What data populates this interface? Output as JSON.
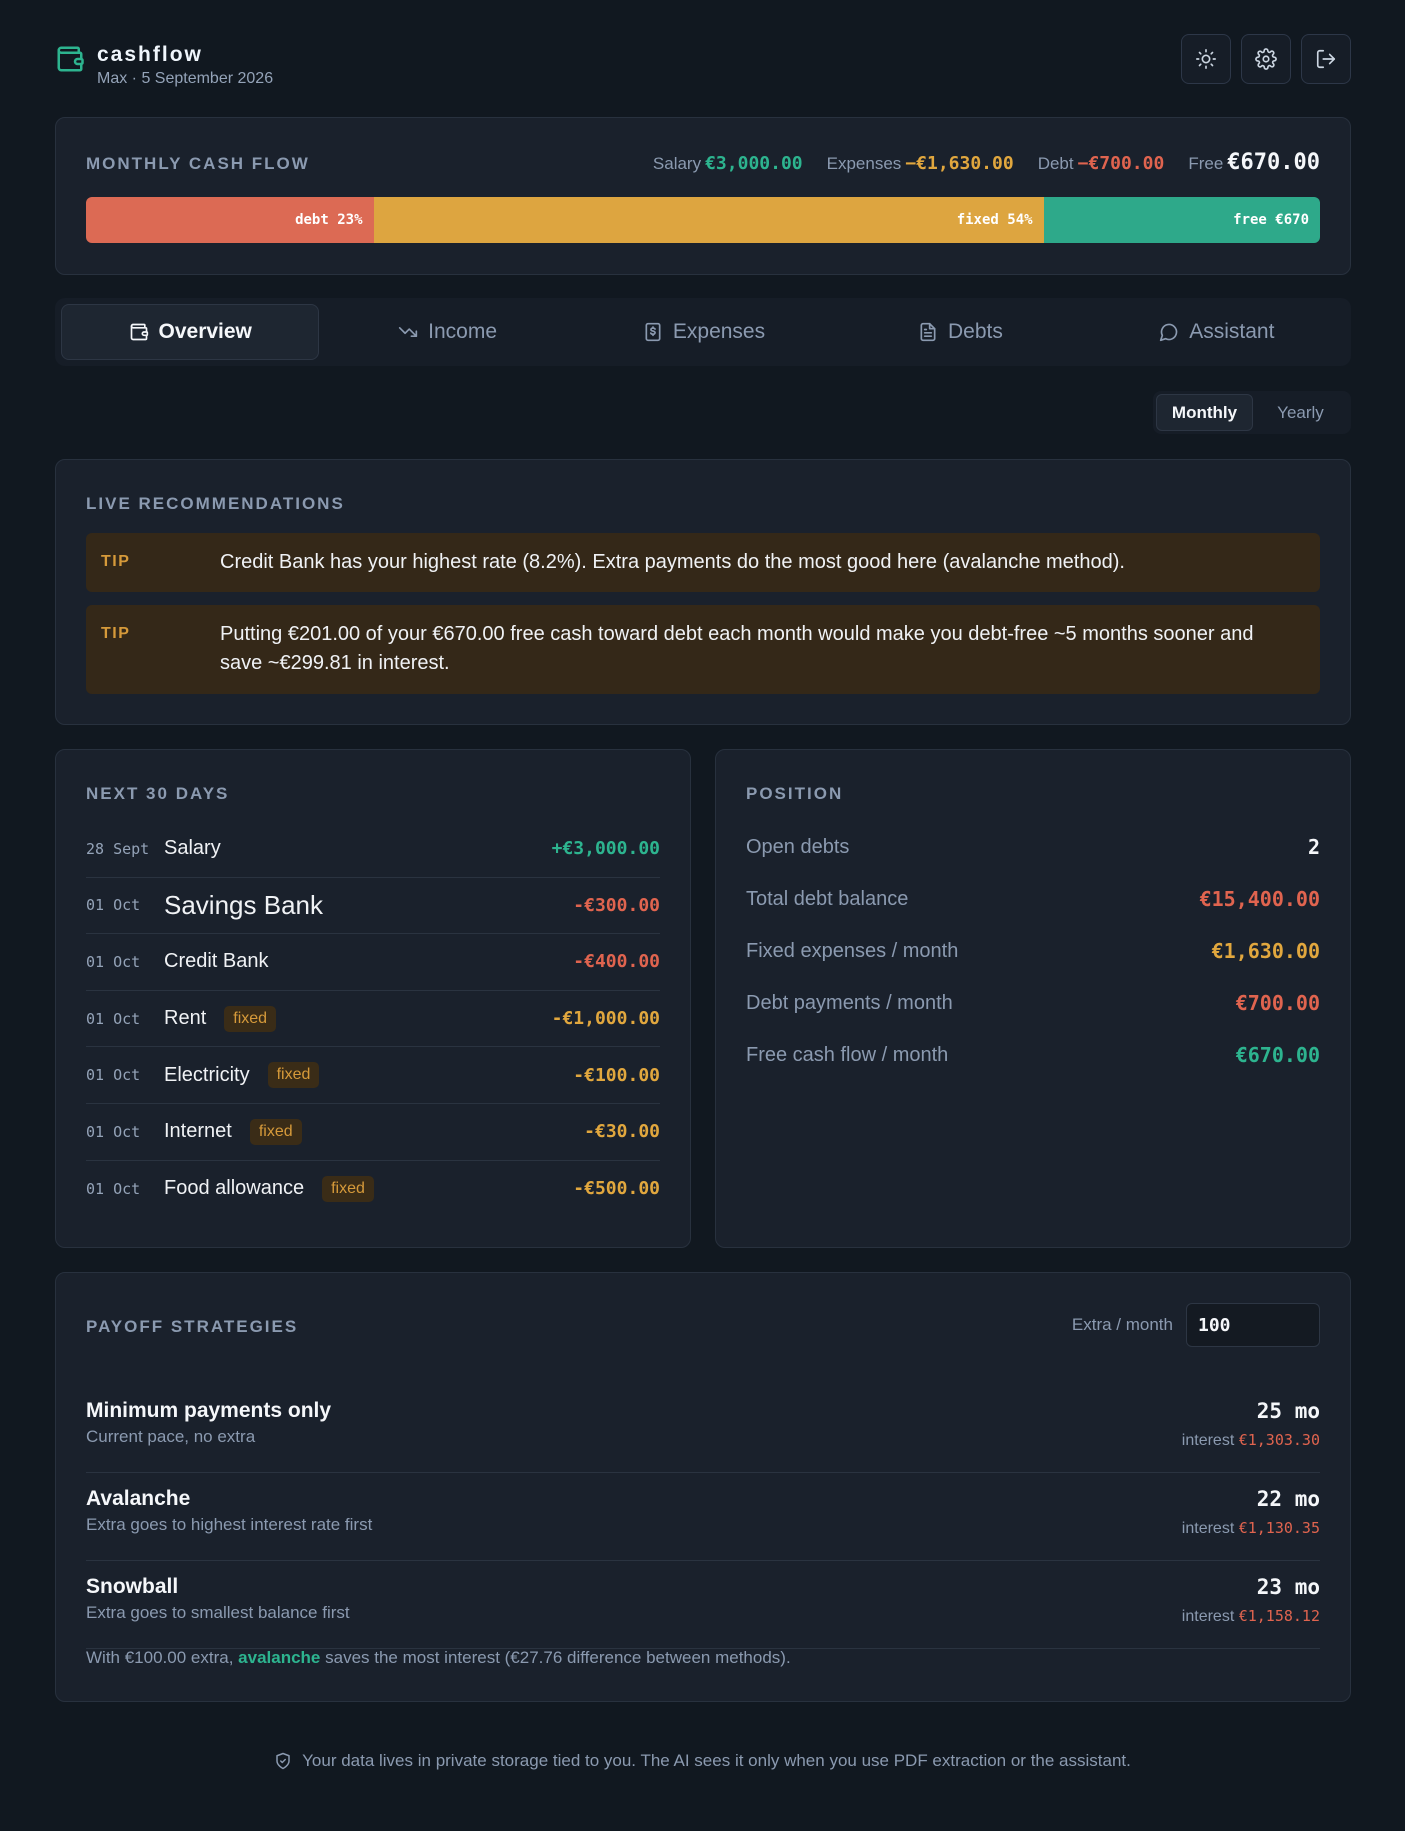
{
  "header": {
    "app_name": "cashflow",
    "subtitle": "Max · 5 September 2026",
    "icons": [
      "wallet-icon",
      "sun-icon",
      "gear-icon",
      "logout-icon"
    ]
  },
  "cashflow": {
    "title": "MONTHLY CASH FLOW",
    "salary_label": "Salary",
    "salary_value": "€3,000.00",
    "expenses_label": "Expenses",
    "expenses_value": "−€1,630.00",
    "debt_label": "Debt",
    "debt_value": "−€700.00",
    "free_label": "Free",
    "free_value": "€670.00",
    "bar": {
      "debt_label": "debt 23%",
      "debt_fraction": 0.233,
      "fixed_label": "fixed 54%",
      "fixed_fraction": 0.543,
      "free_label": "free €670",
      "free_fraction": 0.224
    },
    "colors": {
      "debt": "#dc6a54",
      "fixed": "#dda540",
      "free": "#2ea98a"
    }
  },
  "tabs": [
    {
      "label": "Overview",
      "icon": "wallet-icon",
      "active": true
    },
    {
      "label": "Income",
      "icon": "trend-down-icon",
      "active": false
    },
    {
      "label": "Expenses",
      "icon": "receipt-dollar-icon",
      "active": false
    },
    {
      "label": "Debts",
      "icon": "document-icon",
      "active": false
    },
    {
      "label": "Assistant",
      "icon": "chat-bubble-icon",
      "active": false
    }
  ],
  "period_toggle": {
    "monthly": "Monthly",
    "yearly": "Yearly",
    "selected": "Monthly"
  },
  "recommendations": {
    "title": "LIVE RECOMMENDATIONS",
    "items": [
      {
        "tag": "TIP",
        "text": "Credit Bank has your highest rate (8.2%). Extra payments do the most good here (avalanche method)."
      },
      {
        "tag": "TIP",
        "text": "Putting €201.00 of your €670.00 free cash toward debt each month would make you debt-free ~5 months sooner and save ~€299.81 in interest."
      }
    ]
  },
  "next30": {
    "title": "NEXT 30 DAYS",
    "rows": [
      {
        "date": "28 Sept",
        "name": "Salary",
        "badge": "",
        "amount": "+€3,000.00",
        "color": "green"
      },
      {
        "date": "01 Oct",
        "name": "Savings Bank",
        "badge": "",
        "amount": "-€300.00",
        "color": "red"
      },
      {
        "date": "01 Oct",
        "name": "Credit Bank",
        "badge": "",
        "amount": "-€400.00",
        "color": "red"
      },
      {
        "date": "01 Oct",
        "name": "Rent",
        "badge": "fixed",
        "amount": "-€1,000.00",
        "color": "amber"
      },
      {
        "date": "01 Oct",
        "name": "Electricity",
        "badge": "fixed",
        "amount": "-€100.00",
        "color": "amber"
      },
      {
        "date": "01 Oct",
        "name": "Internet",
        "badge": "fixed",
        "amount": "-€30.00",
        "color": "amber"
      },
      {
        "date": "01 Oct",
        "name": "Food allowance",
        "badge": "fixed",
        "amount": "-€500.00",
        "color": "amber"
      }
    ]
  },
  "position": {
    "title": "POSITION",
    "rows": [
      {
        "label": "Open debts",
        "value": "2",
        "color": "white"
      },
      {
        "label": "Total debt balance",
        "value": "€15,400.00",
        "color": "red"
      },
      {
        "label": "Fixed expenses / month",
        "value": "€1,630.00",
        "color": "amber"
      },
      {
        "label": "Debt payments / month",
        "value": "€700.00",
        "color": "red"
      },
      {
        "label": "Free cash flow / month",
        "value": "€670.00",
        "color": "green"
      }
    ]
  },
  "payoff": {
    "title": "PAYOFF STRATEGIES",
    "extra_label": "Extra / month",
    "extra_value": "100",
    "interest_label": "interest",
    "strategies": [
      {
        "name": "Minimum payments only",
        "desc": "Current pace, no extra",
        "months": "25 mo",
        "interest": "€1,303.30"
      },
      {
        "name": "Avalanche",
        "desc": "Extra goes to highest interest rate first",
        "months": "22 mo",
        "interest": "€1,130.35"
      },
      {
        "name": "Snowball",
        "desc": "Extra goes to smallest balance first",
        "months": "23 mo",
        "interest": "€1,158.12"
      }
    ],
    "summary_prefix": "With €100.00 extra,",
    "summary_highlight": "avalanche",
    "summary_suffix": "saves the most interest (€27.76 difference between methods)."
  },
  "footer": {
    "icon": "shield-check-icon",
    "text": "Your data lives in private storage tied to you. The AI sees it only when you use PDF extraction or the assistant."
  }
}
